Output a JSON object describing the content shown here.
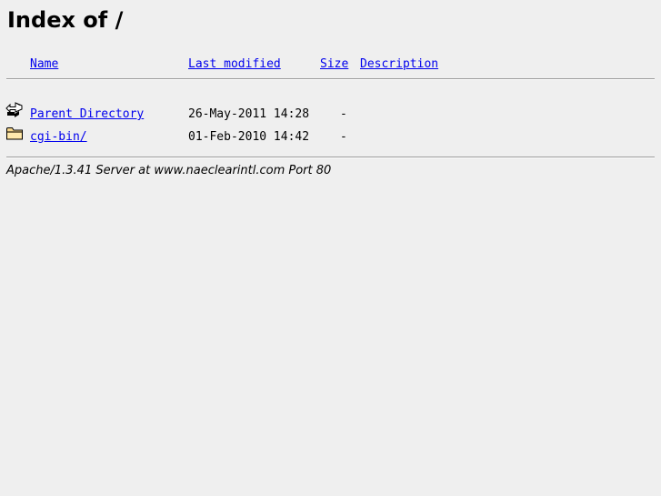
{
  "page": {
    "title": "Index of /"
  },
  "table": {
    "headers": {
      "name": "Name",
      "last_modified": "Last modified",
      "size": "Size",
      "description": "Description"
    },
    "rows": [
      {
        "icon": "back-arrow-icon",
        "name": "Parent Directory",
        "last_modified": "26-May-2011 14:28",
        "size": "-",
        "description": ""
      },
      {
        "icon": "folder-icon",
        "name": "cgi-bin/",
        "last_modified": "01-Feb-2010 14:42",
        "size": "-",
        "description": ""
      }
    ]
  },
  "footer": {
    "server_signature": "Apache/1.3.41 Server at www.naeclearintl.com Port 80"
  },
  "colors": {
    "background": "#efefef",
    "link": "#0000ee"
  }
}
